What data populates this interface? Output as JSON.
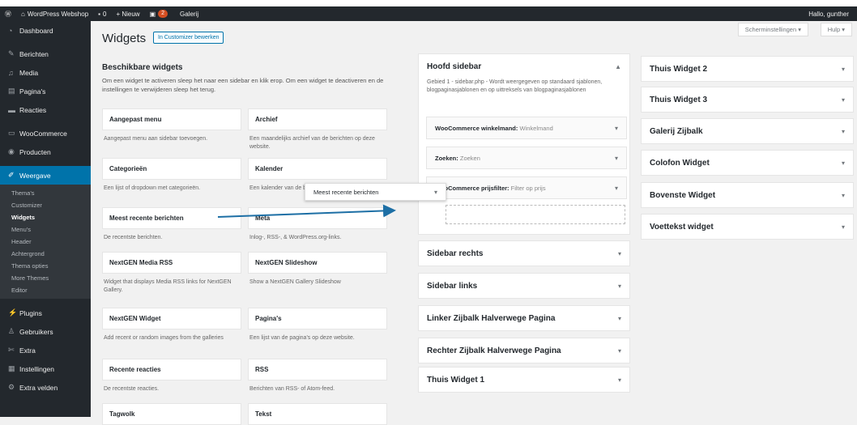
{
  "adminbar": {
    "site_name": "WordPress Webshop",
    "comments_count": "0",
    "new_label": "+ Nieuw",
    "updates_count": "2",
    "gallery_label": "Galerij",
    "greeting": "Hallo, gunther"
  },
  "sidebar": {
    "items": [
      {
        "label": "Dashboard",
        "icon": "dashboard-icon"
      },
      {
        "label": "Berichten",
        "icon": "pin-icon"
      },
      {
        "label": "Media",
        "icon": "media-icon"
      },
      {
        "label": "Pagina's",
        "icon": "page-icon"
      },
      {
        "label": "Reacties",
        "icon": "comment-icon"
      },
      {
        "label": "WooCommerce",
        "icon": "woocommerce-icon"
      },
      {
        "label": "Producten",
        "icon": "product-icon"
      },
      {
        "label": "Weergave",
        "icon": "brush-icon"
      }
    ],
    "submenu": [
      "Thema's",
      "Customizer",
      "Widgets",
      "Menu's",
      "Header",
      "Achtergrond",
      "Thema opties",
      "More Themes",
      "Editor"
    ],
    "items_after": [
      {
        "label": "Plugins",
        "icon": "plugin-icon"
      },
      {
        "label": "Gebruikers",
        "icon": "users-icon"
      },
      {
        "label": "Extra",
        "icon": "tools-icon"
      },
      {
        "label": "Instellingen",
        "icon": "settings-icon"
      },
      {
        "label": "Extra velden",
        "icon": "fields-icon"
      }
    ]
  },
  "header": {
    "screen_options": "Scherminstellingen ▾",
    "help": "Hulp ▾",
    "title": "Widgets",
    "customizer_button": "In Customizer bewerken"
  },
  "available": {
    "title": "Beschikbare widgets",
    "description": "Om een widget te activeren sleep het naar een sidebar en klik erop. Om een widget te deactiveren en de instellingen te verwijderen sleep het terug.",
    "widgets": [
      {
        "name": "Aangepast menu",
        "desc": "Aangepast menu aan sidebar toevoegen."
      },
      {
        "name": "Archief",
        "desc": "Een maandelijks archief van de berichten op deze website."
      },
      {
        "name": "Categorieën",
        "desc": "Een lijst of dropdown met categorieën."
      },
      {
        "name": "Kalender",
        "desc": "Een kalender van de berichten op deze website."
      },
      {
        "name": "Meest recente berichten",
        "desc": "De recentste berichten."
      },
      {
        "name": "Meta",
        "desc": "Inlog-, RSS-, & WordPress.org-links."
      },
      {
        "name": "NextGEN Media RSS",
        "desc": "Widget that displays Media RSS links for NextGEN Gallery."
      },
      {
        "name": "NextGEN Slideshow",
        "desc": "Show a NextGEN Gallery Slideshow"
      },
      {
        "name": "NextGEN Widget",
        "desc": "Add recent or random images from the galleries"
      },
      {
        "name": "Pagina's",
        "desc": "Een lijst van de pagina's op deze website."
      },
      {
        "name": "Recente reacties",
        "desc": "De recentste reacties."
      },
      {
        "name": "RSS",
        "desc": "Berichten van RSS- of Atom-feed."
      },
      {
        "name": "Tagwolk",
        "desc": ""
      },
      {
        "name": "Tekst",
        "desc": ""
      }
    ]
  },
  "hoofd_sidebar": {
    "title": "Hoofd sidebar",
    "description": "Gebied 1 - sidebar.php - Wordt weergegeven op standaard sjablonen, blogpaginasjablonen en op uittreksels van blogpaginasjablonen",
    "widgets": [
      {
        "bold": "WooCommerce winkelmand:",
        "sub": "Winkelmand"
      },
      {
        "bold": "Zoeken:",
        "sub": "Zoeken"
      },
      {
        "bold": "WooCommerce prijsfilter:",
        "sub": "Filter op prijs"
      }
    ],
    "drag_label": "Meest recente berichten"
  },
  "middle_areas": [
    "Sidebar rechts",
    "Sidebar links",
    "Linker Zijbalk Halverwege Pagina",
    "Rechter Zijbalk Halverwege Pagina",
    "Thuis Widget 1"
  ],
  "right_areas": [
    "Thuis Widget 2",
    "Thuis Widget 3",
    "Galerij Zijbalk",
    "Colofon Widget",
    "Bovenste Widget",
    "Voettekst widget"
  ],
  "colors": {
    "admin_dark": "#23282d",
    "accent": "#0073aa",
    "background": "#f1f1f1"
  }
}
